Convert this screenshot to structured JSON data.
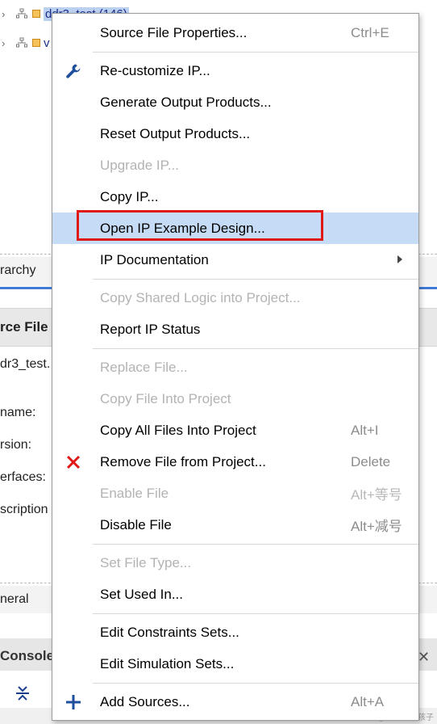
{
  "tree": {
    "rows": [
      {
        "label": "ddr3_test (146)",
        "selected": true
      },
      {
        "label": "v",
        "selected": false
      }
    ]
  },
  "background": {
    "hierarchy_tab": "rarchy",
    "props_title": "rce File",
    "file_name": "dr3_test.",
    "fields": [
      "name:",
      "rsion:",
      "erfaces:",
      "scription"
    ],
    "general_tab": "neral",
    "console_tab": "Console",
    "bottom_partial": "Console   Messages   Log",
    "watermark": "CSDN @爱青跑的孩子"
  },
  "colors": {
    "hover": "#c6dcf6",
    "highlight_border": "#e01818",
    "tab_accent": "#3f7bd6"
  },
  "menu": {
    "items": [
      {
        "label": "Source File Properties...",
        "shortcut": "Ctrl+E",
        "disabled": false,
        "icon": ""
      },
      {
        "label": "Re-customize IP...",
        "shortcut": "",
        "disabled": false,
        "icon": "wrench-icon"
      },
      {
        "label": "Generate Output Products...",
        "shortcut": "",
        "disabled": false,
        "icon": ""
      },
      {
        "label": "Reset Output Products...",
        "shortcut": "",
        "disabled": false,
        "icon": ""
      },
      {
        "label": "Upgrade IP...",
        "shortcut": "",
        "disabled": true,
        "icon": ""
      },
      {
        "label": "Copy IP...",
        "shortcut": "",
        "disabled": false,
        "icon": ""
      },
      {
        "label": "Open IP Example Design...",
        "shortcut": "",
        "disabled": false,
        "icon": "",
        "hover": true,
        "highlighted": true
      },
      {
        "label": "IP Documentation",
        "shortcut": "",
        "disabled": false,
        "icon": "",
        "submenu": true
      },
      {
        "label": "Copy Shared Logic into Project...",
        "shortcut": "",
        "disabled": true,
        "icon": ""
      },
      {
        "label": "Report IP Status",
        "shortcut": "",
        "disabled": false,
        "icon": ""
      },
      {
        "label": "Replace File...",
        "shortcut": "",
        "disabled": true,
        "icon": ""
      },
      {
        "label": "Copy File Into Project",
        "shortcut": "",
        "disabled": true,
        "icon": ""
      },
      {
        "label": "Copy All Files Into Project",
        "shortcut": "Alt+I",
        "disabled": false,
        "icon": ""
      },
      {
        "label": "Remove File from Project...",
        "shortcut": "Delete",
        "disabled": false,
        "icon": "remove-x-icon"
      },
      {
        "label": "Enable File",
        "shortcut": "Alt+等号",
        "disabled": true,
        "icon": ""
      },
      {
        "label": "Disable File",
        "shortcut": "Alt+减号",
        "disabled": false,
        "icon": ""
      },
      {
        "label": "Set File Type...",
        "shortcut": "",
        "disabled": true,
        "icon": ""
      },
      {
        "label": "Set Used In...",
        "shortcut": "",
        "disabled": false,
        "icon": ""
      },
      {
        "label": "Edit Constraints Sets...",
        "shortcut": "",
        "disabled": false,
        "icon": ""
      },
      {
        "label": "Edit Simulation Sets...",
        "shortcut": "",
        "disabled": false,
        "icon": ""
      },
      {
        "label": "Add Sources...",
        "shortcut": "Alt+A",
        "disabled": false,
        "icon": "plus-icon"
      }
    ]
  }
}
